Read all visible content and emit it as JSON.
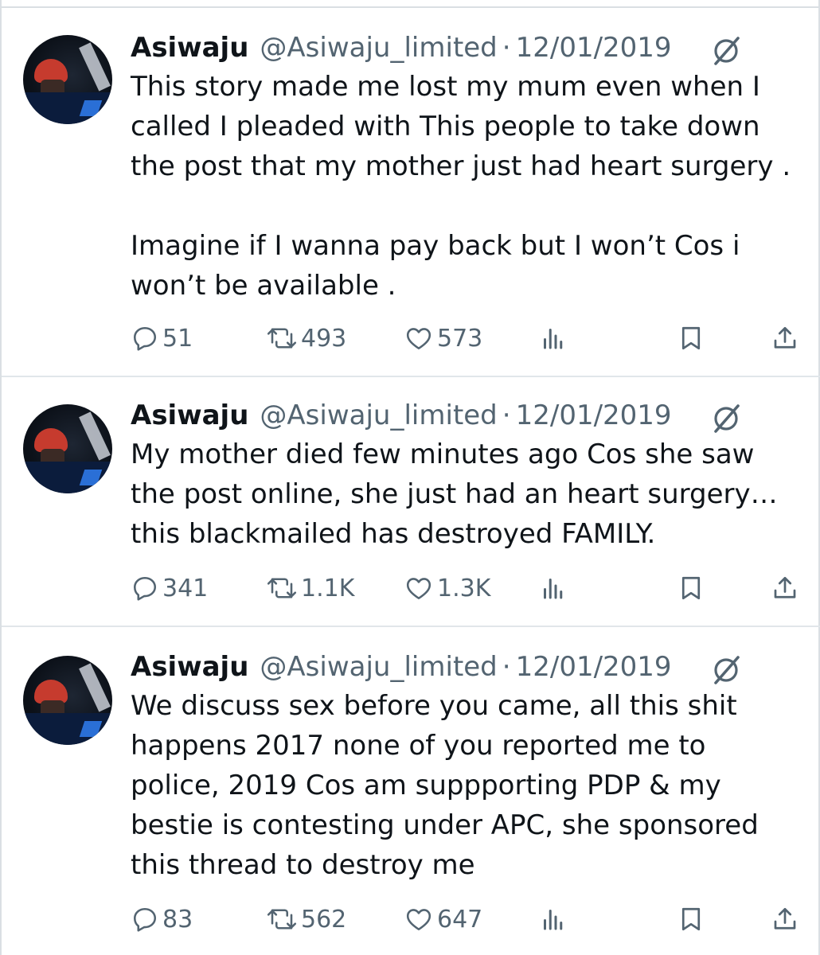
{
  "tweets": [
    {
      "name": "Asiwaju",
      "handle": "@Asiwaju_limited",
      "separator": "·",
      "date": "12/01/2019",
      "paragraphs": [
        [
          "This story made me lost my mum even when I",
          "called I pleaded with This people to take down",
          "the post that my mother just had heart surgery ."
        ],
        [
          "Imagine if I wanna pay back but I won’t Cos i",
          "won’t be available ."
        ]
      ],
      "replies": "51",
      "reposts": "493",
      "likes": "573"
    },
    {
      "name": "Asiwaju",
      "handle": "@Asiwaju_limited",
      "separator": "·",
      "date": "12/01/2019",
      "paragraphs": [
        [
          "My mother died few minutes ago Cos she saw",
          "the post online, she just had an heart surgery…",
          "this blackmailed has destroyed FAMILY."
        ]
      ],
      "replies": "341",
      "reposts": "1.1K",
      "likes": "1.3K"
    },
    {
      "name": "Asiwaju",
      "handle": "@Asiwaju_limited",
      "separator": "·",
      "date": "12/01/2019",
      "paragraphs": [
        [
          "We discuss sex before you came, all this shit",
          "happens 2017 none of you reported me to",
          "police, 2019 Cos am suppporting PDP & my",
          "bestie is contesting under APC, she sponsored",
          "this thread to destroy me"
        ]
      ],
      "replies": "83",
      "reposts": "562",
      "likes": "647"
    }
  ],
  "icons": {
    "reply": "reply-icon",
    "repost": "repost-icon",
    "like": "like-icon",
    "views": "views-icon",
    "bookmark": "bookmark-icon",
    "share": "share-icon",
    "grok": "grok-icon"
  },
  "colors": {
    "text": "#0f1419",
    "muted": "#536471",
    "divider": "#e1e6ea"
  }
}
